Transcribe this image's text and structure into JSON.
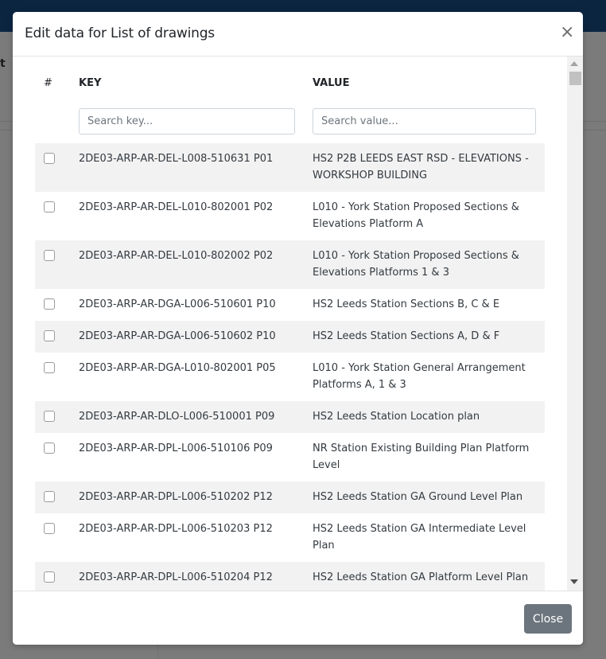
{
  "modal": {
    "title": "Edit data for List of drawings",
    "close_glyph": "×",
    "footer": {
      "close_label": "Close"
    }
  },
  "background": {
    "partial_text": "t"
  },
  "table": {
    "headers": {
      "num": "#",
      "key": "KEY",
      "value": "VALUE"
    },
    "search": {
      "key_placeholder": "Search key...",
      "key_value": "",
      "value_placeholder": "Search value...",
      "value_value": ""
    },
    "rows": [
      {
        "checked": false,
        "key": "2DE03-ARP-AR-DEL-L008-510631 P01",
        "value": "HS2 P2B LEEDS EAST RSD - ELEVATIONS - WORKSHOP BUILDING"
      },
      {
        "checked": false,
        "key": "2DE03-ARP-AR-DEL-L010-802001 P02",
        "value": "L010 - York Station Proposed Sections & Elevations Platform A"
      },
      {
        "checked": false,
        "key": "2DE03-ARP-AR-DEL-L010-802002 P02",
        "value": "L010 - York Station Proposed Sections & Elevations Platforms 1 & 3"
      },
      {
        "checked": false,
        "key": "2DE03-ARP-AR-DGA-L006-510601 P10",
        "value": "HS2 Leeds Station Sections B, C & E"
      },
      {
        "checked": false,
        "key": "2DE03-ARP-AR-DGA-L006-510602 P10",
        "value": "HS2 Leeds Station Sections A, D & F"
      },
      {
        "checked": false,
        "key": "2DE03-ARP-AR-DGA-L010-802001 P05",
        "value": "L010 - York Station General Arrangement Platforms A, 1 & 3"
      },
      {
        "checked": false,
        "key": "2DE03-ARP-AR-DLO-L006-510001 P09",
        "value": "HS2 Leeds Station Location plan"
      },
      {
        "checked": false,
        "key": "2DE03-ARP-AR-DPL-L006-510106 P09",
        "value": "NR Station Existing Building Plan Platform Level"
      },
      {
        "checked": false,
        "key": "2DE03-ARP-AR-DPL-L006-510202 P12",
        "value": "HS2 Leeds Station GA Ground Level Plan"
      },
      {
        "checked": false,
        "key": "2DE03-ARP-AR-DPL-L006-510203 P12",
        "value": "HS2 Leeds Station GA Intermediate Level Plan"
      },
      {
        "checked": false,
        "key": "2DE03-ARP-AR-DPL-L006-510204 P12",
        "value": "HS2 Leeds Station GA Platform Level Plan"
      }
    ]
  }
}
